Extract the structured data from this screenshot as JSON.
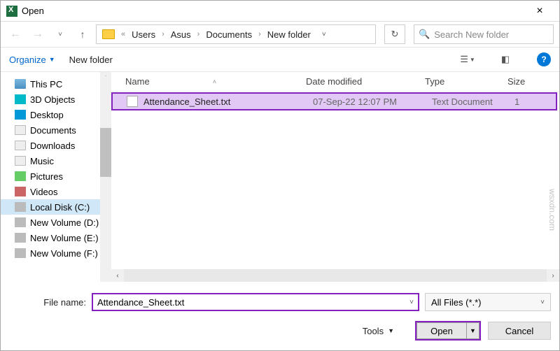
{
  "window": {
    "title": "Open"
  },
  "breadcrumb": {
    "prefix": "«",
    "items": [
      "Users",
      "Asus",
      "Documents",
      "New folder"
    ]
  },
  "search": {
    "placeholder": "Search New folder"
  },
  "toolbar": {
    "organize": "Organize",
    "new_folder": "New folder"
  },
  "sidebar": {
    "items": [
      {
        "label": "This PC"
      },
      {
        "label": "3D Objects"
      },
      {
        "label": "Desktop"
      },
      {
        "label": "Documents"
      },
      {
        "label": "Downloads"
      },
      {
        "label": "Music"
      },
      {
        "label": "Pictures"
      },
      {
        "label": "Videos"
      },
      {
        "label": "Local Disk (C:)"
      },
      {
        "label": "New Volume (D:)"
      },
      {
        "label": "New Volume (E:)"
      },
      {
        "label": "New Volume (F:)"
      }
    ]
  },
  "columns": {
    "name": "Name",
    "date_modified": "Date modified",
    "type": "Type",
    "size": "Size"
  },
  "files": [
    {
      "name": "Attendance_Sheet.txt",
      "date_modified": "07-Sep-22 12:07 PM",
      "type": "Text Document",
      "size": "1"
    }
  ],
  "filename": {
    "label": "File name:",
    "value": "Attendance_Sheet.txt"
  },
  "filter": {
    "label": "All Files (*.*)"
  },
  "buttons": {
    "tools": "Tools",
    "open": "Open",
    "cancel": "Cancel"
  },
  "watermark": "wsxdn.com"
}
